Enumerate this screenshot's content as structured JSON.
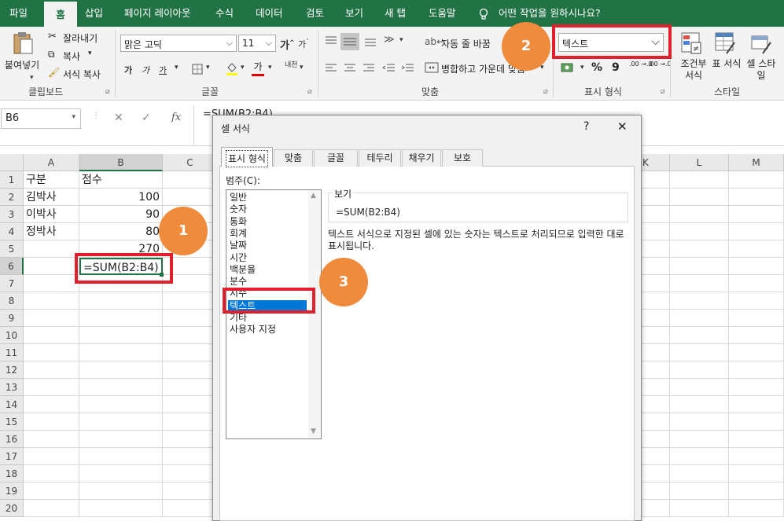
{
  "menu": {
    "tabs": [
      "파일",
      "홈",
      "삽입",
      "페이지 레이아웃",
      "수식",
      "데이터",
      "검토",
      "보기",
      "새 탭",
      "도움말"
    ],
    "tell_me": "어떤 작업을 원하시나요?"
  },
  "ribbon": {
    "clipboard": {
      "paste": "붙여넣기",
      "cut": "잘라내기",
      "copy": "복사",
      "format_painter": "서식 복사",
      "label": "클립보드"
    },
    "font": {
      "name": "맑은 고딕",
      "size": "11",
      "bold": "가",
      "italic": "가",
      "underline": "가",
      "grow": "가",
      "shrink": "가",
      "font_color": "가",
      "phonetic": "내천",
      "label": "글꼴"
    },
    "alignment": {
      "wrap": "자동 줄 바꿈",
      "merge": "병합하고 가운데 맞춤",
      "label": "맞춤"
    },
    "number": {
      "format": "텍스트",
      "percent": "%",
      "comma": "9",
      "dec_inc": ".00 →.0",
      "dec_dec": ".00 →.0",
      "label": "표시 형식"
    },
    "styles": {
      "cond": "조건부 서식",
      "table": "표 서식",
      "cell": "셀 스타일",
      "label": "스타일"
    }
  },
  "formula_bar": {
    "name_box": "B6",
    "cancel": "✕",
    "enter": "✓",
    "fx": "fx",
    "formula": "=SUM(B2:B4)"
  },
  "sheet": {
    "columns": [
      "A",
      "B",
      "C",
      "K",
      "L",
      "M"
    ],
    "rows": [
      "1",
      "2",
      "3",
      "4",
      "5",
      "6",
      "7",
      "8",
      "9",
      "10",
      "11",
      "12",
      "13",
      "14",
      "15",
      "16",
      "17",
      "18",
      "19",
      "20"
    ],
    "cells": {
      "A1": "구분",
      "B1": "점수",
      "A2": "김박사",
      "B2": "100",
      "A3": "이박사",
      "B3": "90",
      "A4": "정박사",
      "B4": "80",
      "B5": "270",
      "B6": "=SUM(B2:B4)"
    }
  },
  "dialog": {
    "title": "셀 서식",
    "help": "?",
    "close": "✕",
    "tabs": [
      "표시 형식",
      "맞춤",
      "글꼴",
      "테두리",
      "채우기",
      "보호"
    ],
    "category_label": "범주(C):",
    "categories": [
      "일반",
      "숫자",
      "통화",
      "회계",
      "날짜",
      "시간",
      "백분율",
      "분수",
      "지수",
      "텍스트",
      "기타",
      "사용자 지정"
    ],
    "selected_category": "텍스트",
    "sample_label": "보기",
    "sample_value": "=SUM(B2:B4)",
    "description": "텍스트 서식으로 지정된 셀에 있는 숫자는 텍스트로 처리되므로 입력한 대로 표시됩니다."
  },
  "callouts": [
    "1",
    "2",
    "3"
  ],
  "colors": {
    "excel_green": "#217346",
    "highlight_red": "#e0202c",
    "badge_orange": "#ef8b3c",
    "select_blue": "#0078d7"
  }
}
